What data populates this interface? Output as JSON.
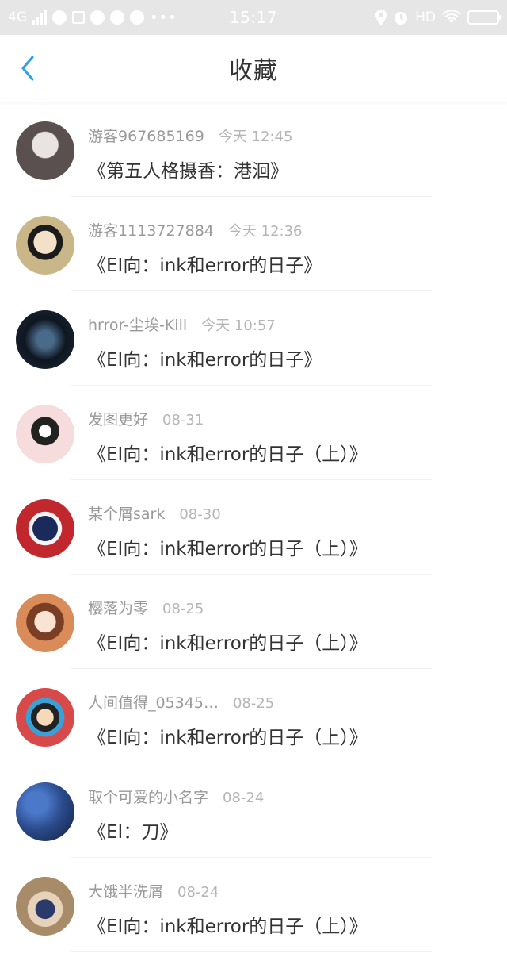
{
  "status_bar": {
    "network": "4G",
    "time": "15:17",
    "hd": "HD",
    "dots": "•••"
  },
  "header": {
    "title": "收藏"
  },
  "favorites": [
    {
      "user": "游客967685169",
      "time": "今天 12:45",
      "title": "《第五人格摄香：港洄》",
      "avatar_color": "#5a5050"
    },
    {
      "user": "游客1113727884",
      "time": "今天 12:36",
      "title": "《EI向：ink和error的日子》",
      "avatar_color": "#c9b78a"
    },
    {
      "user": "hrror-尘埃-Kill",
      "time": "今天 10:57",
      "title": "《EI向：ink和error的日子》",
      "avatar_color": "#1e2a3a"
    },
    {
      "user": "发图更好",
      "time": "08-31",
      "title": "《EI向：ink和error的日子（上）》",
      "avatar_color": "#f6dcdc"
    },
    {
      "user": "某个屑sark",
      "time": "08-30",
      "title": "《EI向：ink和error的日子（上）》",
      "avatar_color": "#c0282e"
    },
    {
      "user": "樱落为零",
      "time": "08-25",
      "title": "《EI向：ink和error的日子（上）》",
      "avatar_color": "#d98b5a"
    },
    {
      "user": "人间值得_05345…",
      "time": "08-25",
      "title": "《EI向：ink和error的日子（上）》",
      "avatar_color": "#d84a4a"
    },
    {
      "user": "取个可爱的小名字",
      "time": "08-24",
      "title": "《EI：刀》",
      "avatar_color": "#2a4a8a"
    },
    {
      "user": "大饿半洗屑",
      "time": "08-24",
      "title": "《EI向：ink和error的日子（上）》",
      "avatar_color": "#a88c6a"
    }
  ],
  "colors": {
    "accent": "#2a9ff0",
    "status_bar_bg": "#e6e6e6"
  },
  "icons": {
    "back": "chevron-left-icon",
    "location": "location-icon",
    "alarm": "alarm-icon",
    "wifi": "wifi-icon",
    "battery": "battery-icon"
  }
}
